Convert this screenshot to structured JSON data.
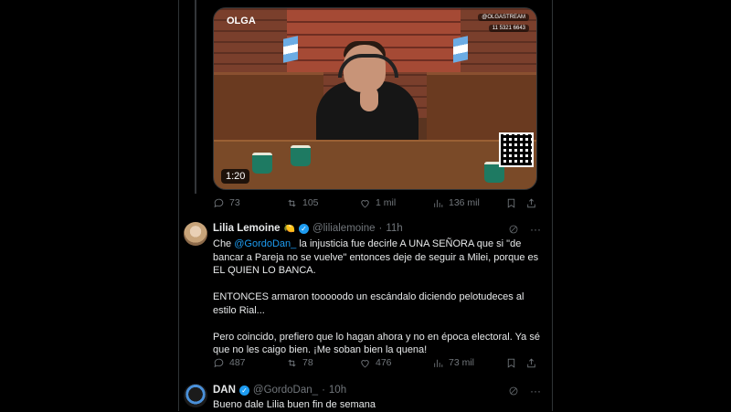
{
  "video": {
    "logo": "OLGA",
    "tag_top": "@OLGASTREAM",
    "tag_phone": "11 5321 6643",
    "duration": "1:20"
  },
  "tweet1_actions": {
    "replies": "73",
    "reposts": "105",
    "likes": "1 mil",
    "views": "136 mil"
  },
  "tweet2": {
    "name": "Lilia Lemoine",
    "emoji": "🍋",
    "handle": "@lilialemoine",
    "dot": "·",
    "time": "11h",
    "more": "···",
    "para1_prefix": "Che ",
    "para1_mention": "@GordoDan_",
    "para1_rest": " la injusticia fue decirle A UNA SEÑORA que si \"de bancar a Pareja no se vuelve\" entonces deje de seguir a Milei, porque es EL QUIEN LO BANCA.",
    "para2": "ENTONCES armaron tooooodo un escándalo diciendo pelotudeces al estilo Rial...",
    "para3": "Pero coincido, prefiero que lo hagan ahora y no en época electoral. Ya sé que no les caigo bien. ¡Me soban bien la quena!",
    "actions": {
      "replies": "487",
      "reposts": "78",
      "likes": "476",
      "views": "73 mil"
    }
  },
  "tweet3": {
    "name": "DAN",
    "handle": "@GordoDan_",
    "dot": "·",
    "time": "10h",
    "more": "···",
    "text": "Bueno dale Lilia buen fin de semana"
  },
  "colors": {
    "accent": "#1d9bf0",
    "muted": "#71767b",
    "background": "#000000"
  },
  "icons": [
    "reply-icon",
    "repost-icon",
    "like-icon",
    "views-icon",
    "bookmark-icon",
    "share-icon",
    "grok-icon",
    "verified-icon"
  ]
}
